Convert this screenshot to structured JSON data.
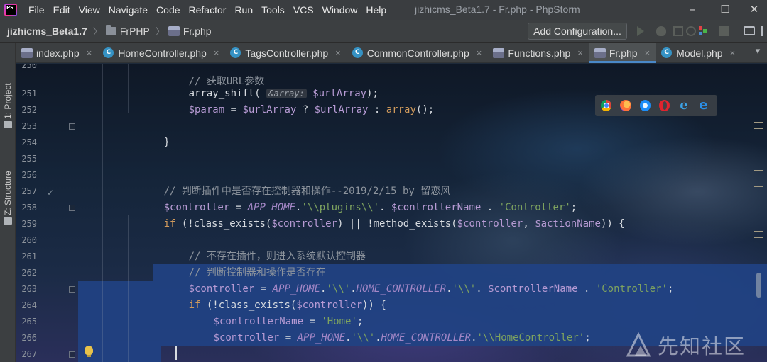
{
  "app": {
    "icon_text": "PS",
    "window_title": "jizhicms_Beta1.7 - Fr.php - PhpStorm"
  },
  "menu": [
    "File",
    "Edit",
    "View",
    "Navigate",
    "Code",
    "Refactor",
    "Run",
    "Tools",
    "VCS",
    "Window",
    "Help"
  ],
  "window_controls": {
    "minimize": "–",
    "maximize": "☐",
    "close": "✕"
  },
  "breadcrumb": {
    "project": "jizhicms_Beta1.7",
    "folder": "FrPHP",
    "file": "Fr.php",
    "separator": "〉"
  },
  "toolbar": {
    "add_configuration": "Add Configuration..."
  },
  "tool_windows": {
    "project": "1: Project",
    "structure": "Z: Structure"
  },
  "tabs": [
    {
      "label": "index.php",
      "icon": "php-file-icon",
      "active": false
    },
    {
      "label": "HomeController.php",
      "icon": "class-icon",
      "active": false
    },
    {
      "label": "TagsController.php",
      "icon": "class-icon",
      "active": false
    },
    {
      "label": "CommonController.php",
      "icon": "class-icon",
      "active": false
    },
    {
      "label": "Functions.php",
      "icon": "php-file-icon",
      "active": false
    },
    {
      "label": "Fr.php",
      "icon": "php-file-icon",
      "active": true
    },
    {
      "label": "Model.php",
      "icon": "class-icon",
      "active": false
    }
  ],
  "tab_close": "×",
  "editor": {
    "line_numbers": [
      "250",
      "251",
      "252",
      "253",
      "254",
      "255",
      "256",
      "257",
      "258",
      "259",
      "260",
      "261",
      "262",
      "263",
      "264",
      "265",
      "266",
      "267"
    ],
    "lines": {
      "l250_comment": "// 获取URL参数",
      "l250_fn": "array_shift(",
      "l250_hint": "&array:",
      "l250_var": "$urlArray",
      "l250_end": ");",
      "l251_var1": "$param",
      "l251_eq": " = ",
      "l251_var2": "$urlArray",
      "l251_q": " ? ",
      "l251_var3": "$urlArray",
      "l251_colon": " : ",
      "l251_kw": "array",
      "l251_end": "();",
      "l253": "}",
      "l256_comment": "// 判断插件中是否存在控制器和操作--2019/2/15 by 留恋风",
      "l257_var": "$controller",
      "l257_eq": " = ",
      "l257_const": "APP_HOME",
      "l257_dot1": ".",
      "l257_str1": "'\\\\plugins\\\\'",
      "l257_dot2": ". ",
      "l257_var2": "$controllerName",
      "l257_dot3": " . ",
      "l257_str2": "'Controller'",
      "l257_end": ";",
      "l258_kw": "if",
      "l258_a": " (!",
      "l258_fn1": "class_exists",
      "l258_b": "(",
      "l258_var1": "$controller",
      "l258_c": ") || !",
      "l258_fn2": "method_exists",
      "l258_d": "(",
      "l258_var2": "$controller",
      "l258_e": ", ",
      "l258_var3": "$actionName",
      "l258_f": ")) {",
      "l260_comment": "// 不存在插件，则进入系统默认控制器",
      "l261_comment": "// 判断控制器和操作是否存在",
      "l262_var": "$controller",
      "l262_eq": " = ",
      "l262_const1": "APP_HOME",
      "l262_dot1": ".",
      "l262_str1": "'\\\\'",
      "l262_dot2": ".",
      "l262_const2": "HOME_CONTROLLER",
      "l262_dot3": ".",
      "l262_str2": "'\\\\'",
      "l262_dot4": ". ",
      "l262_var2": "$controllerName",
      "l262_dot5": " . ",
      "l262_str3": "'Controller'",
      "l262_end": ";",
      "l263_kw": "if",
      "l263_a": " (!",
      "l263_fn": "class_exists",
      "l263_b": "(",
      "l263_var": "$controller",
      "l263_c": ")) {",
      "l264_var": "$controllerName",
      "l264_eq": " = ",
      "l264_str": "'Home'",
      "l264_end": ";",
      "l265_var": "$controller",
      "l265_eq": " = ",
      "l265_const1": "APP_HOME",
      "l265_dot1": ".",
      "l265_str1": "'\\\\'",
      "l265_dot2": ".",
      "l265_const2": "HOME_CONTROLLER",
      "l265_dot3": ".",
      "l265_str2": "'\\\\HomeController'",
      "l265_end": ";",
      "l267": "}"
    }
  },
  "gutter": {
    "check": "✓"
  },
  "watermark": {
    "text": "先知社区"
  },
  "colors": {
    "selection": "#214283",
    "keyword": "#d09a5c",
    "variable": "#b79bd4",
    "string": "#7ea35f",
    "constant": "#a387c6",
    "comment": "#8d949d",
    "active_tab_underline": "#4a88c7"
  }
}
